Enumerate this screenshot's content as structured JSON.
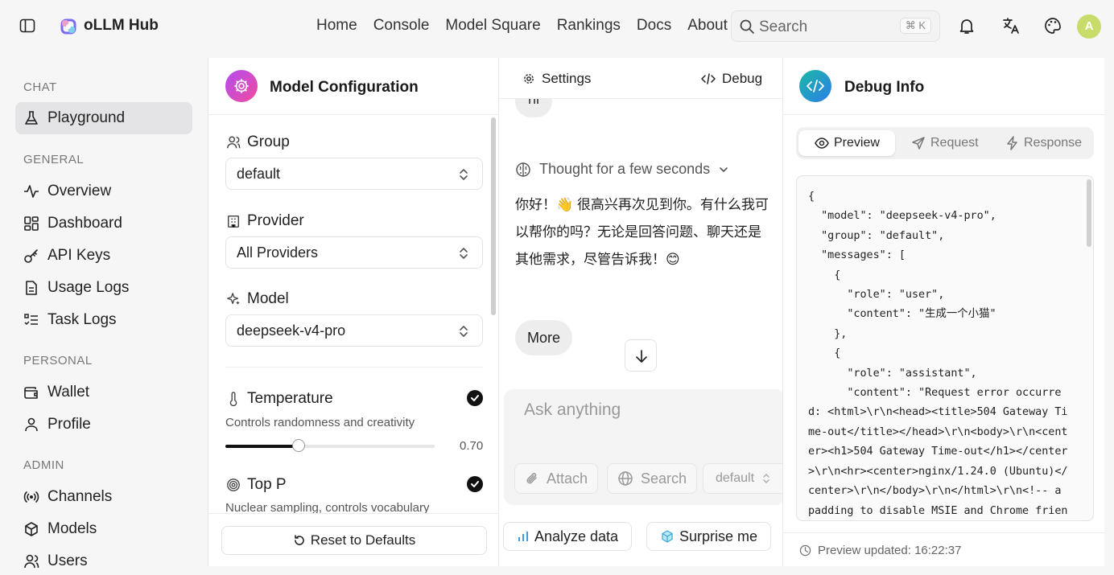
{
  "app": {
    "brand": "oLLM Hub"
  },
  "nav": {
    "items": [
      "Home",
      "Console",
      "Model Square",
      "Rankings",
      "Docs",
      "About"
    ]
  },
  "search": {
    "placeholder": "Search",
    "shortcut": "⌘ K"
  },
  "user": {
    "avatar_letter": "A",
    "avatar_color": "#c7dc6a"
  },
  "sidebar": {
    "sections": {
      "chat": "CHAT",
      "general": "GENERAL",
      "personal": "PERSONAL",
      "admin": "ADMIN"
    },
    "items": {
      "playground": "Playground",
      "overview": "Overview",
      "dashboard": "Dashboard",
      "api_keys": "API Keys",
      "usage_logs": "Usage Logs",
      "task_logs": "Task Logs",
      "wallet": "Wallet",
      "profile": "Profile",
      "channels": "Channels",
      "models": "Models",
      "users": "Users"
    },
    "active": "Playground"
  },
  "config": {
    "title": "Model Configuration",
    "group_label": "Group",
    "group_value": "default",
    "provider_label": "Provider",
    "provider_value": "All Providers",
    "model_label": "Model",
    "model_value": "deepseek-v4-pro",
    "temperature_label": "Temperature",
    "temperature_desc": "Controls randomness and creativity",
    "temperature_value": "0.70",
    "temperature_fraction": 0.35,
    "top_p_label": "Top P",
    "top_p_desc": "Nuclear sampling, controls vocabulary",
    "reset_label": "Reset to Defaults"
  },
  "chat": {
    "settings_tab": "Settings",
    "debug_tab": "Debug",
    "user_message": "hi",
    "thought": "Thought for a few seconds",
    "reply": "你好！👋 很高兴再次见到你。有什么我可以帮你的吗？无论是回答问题、聊天还是其他需求，尽管告诉我！😊",
    "more_label": "More",
    "input_placeholder": "Ask anything",
    "attach_label": "Attach",
    "search_label": "Search",
    "group_select": "default",
    "suggestions": [
      "Analyze data",
      "Surprise me"
    ]
  },
  "debug": {
    "title": "Debug Info",
    "tabs": [
      "Preview",
      "Request",
      "Response"
    ],
    "active_tab": "Preview",
    "code": "{\n  \"model\": \"deepseek-v4-pro\",\n  \"group\": \"default\",\n  \"messages\": [\n    {\n      \"role\": \"user\",\n      \"content\": \"生成一个小猫\"\n    },\n    {\n      \"role\": \"assistant\",\n      \"content\": \"Request error occurre\nd: <html>\\r\\n<head><title>504 Gateway Ti\nme-out</title></head>\\r\\n<body>\\r\\n<cent\ner><h1>504 Gateway Time-out</h1></center\n>\\r\\n<hr><center>nginx/1.24.0 (Ubuntu)</\ncenter>\\r\\n</body>\\r\\n</html>\\r\\n<!-- a\npadding to disable MSIE and Chrome frien",
    "updated": "Preview updated: 16:22:37"
  }
}
